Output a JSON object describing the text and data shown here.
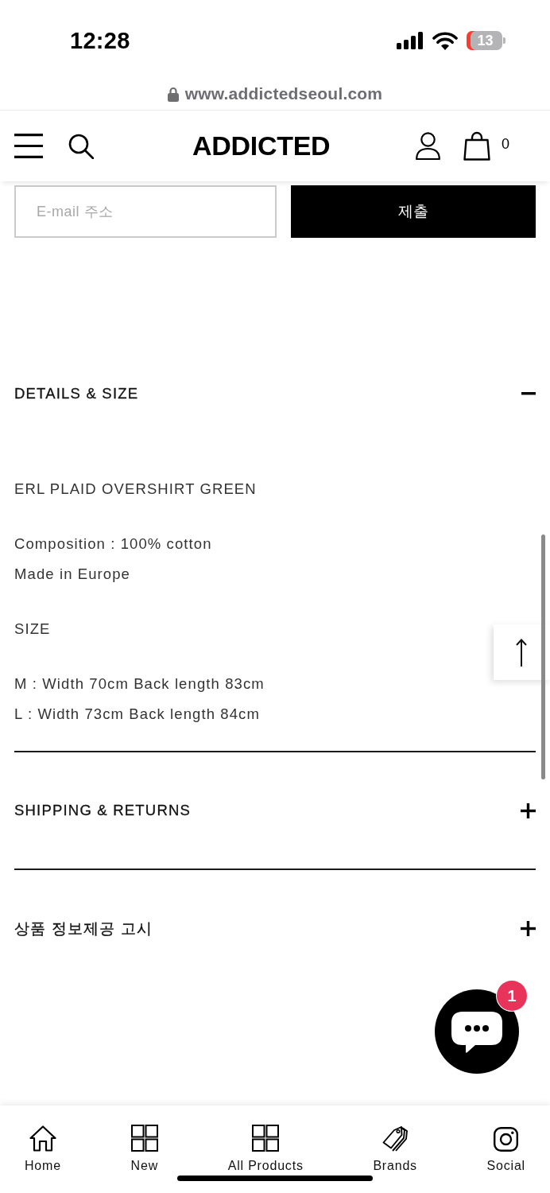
{
  "status_bar": {
    "time": "12:28",
    "battery": "13"
  },
  "browser": {
    "url": "www.addictedseoul.com"
  },
  "header": {
    "logo": "ADDICTED",
    "cart_count": "0"
  },
  "newsletter": {
    "placeholder": "E-mail 주소",
    "button": "제출"
  },
  "accordion": [
    {
      "title": "DETAILS & SIZE",
      "expanded": true,
      "content": [
        [
          "ERL PLAID OVERSHIRT GREEN"
        ],
        [
          "Composition : 100% cotton",
          "Made in Europe"
        ],
        [
          "SIZE"
        ],
        [
          "M : Width 70cm Back length 83cm",
          "L : Width 73cm Back length 84cm"
        ]
      ]
    },
    {
      "title": "SHIPPING & RETURNS",
      "expanded": false
    },
    {
      "title": "상품 정보제공 고시",
      "expanded": false
    }
  ],
  "chat": {
    "badge": "1"
  },
  "bottom_nav": [
    {
      "label": "Home",
      "kind": "home"
    },
    {
      "label": "New",
      "kind": "grid"
    },
    {
      "label": "All Products",
      "kind": "grid"
    },
    {
      "label": "Brands",
      "kind": "tag"
    },
    {
      "label": "Social",
      "kind": "camera"
    }
  ]
}
